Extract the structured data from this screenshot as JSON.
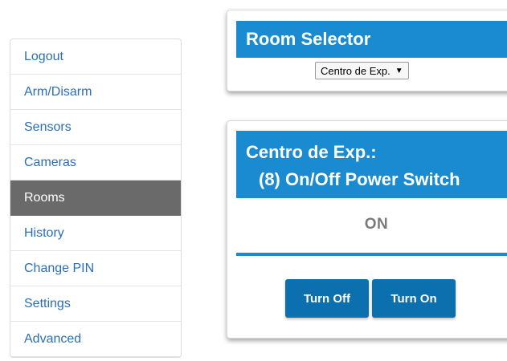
{
  "sidebar": {
    "items": [
      {
        "label": "Logout"
      },
      {
        "label": "Arm/Disarm"
      },
      {
        "label": "Sensors"
      },
      {
        "label": "Cameras"
      },
      {
        "label": "Rooms",
        "active": true
      },
      {
        "label": "History"
      },
      {
        "label": "Change PIN"
      },
      {
        "label": "Settings"
      },
      {
        "label": "Advanced"
      }
    ]
  },
  "room_selector": {
    "title": "Room Selector",
    "selected": "Centro de Exp."
  },
  "device_panel": {
    "room": "Centro de Exp.:",
    "device": "(8) On/Off Power Switch",
    "status": "ON",
    "turn_off_label": "Turn Off",
    "turn_on_label": "Turn On"
  },
  "colors": {
    "accent": "#1a8bd0",
    "button": "#0c6fae",
    "active_nav": "#6a6a6a",
    "link": "#2a6fb5"
  }
}
